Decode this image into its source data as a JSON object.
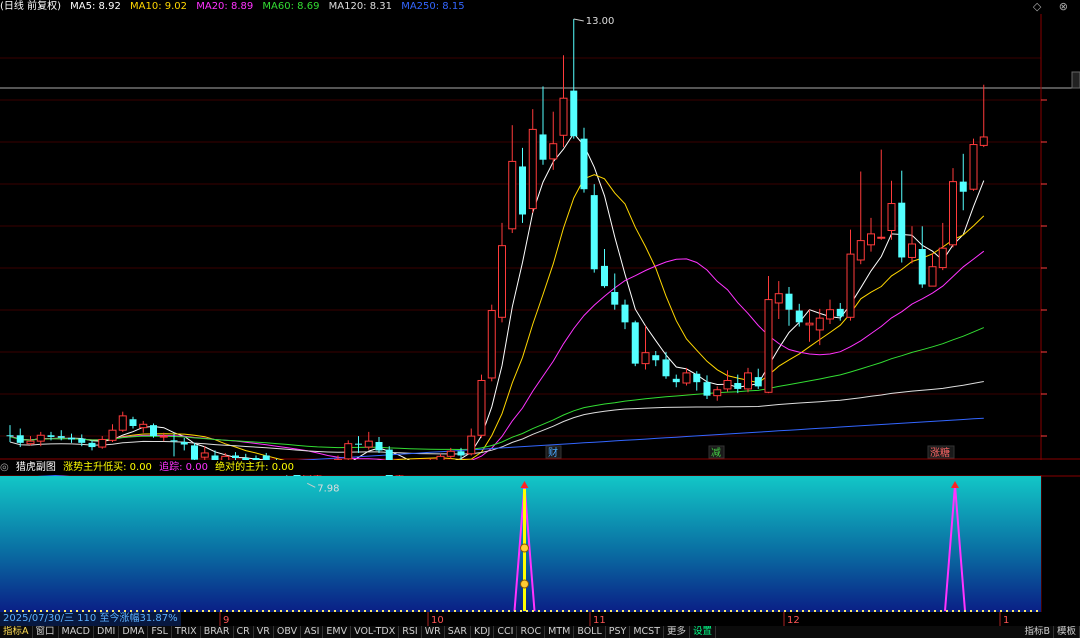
{
  "top_bar": {
    "title": "(日线 前复权)",
    "ma": [
      {
        "label": "MA5: 8.92",
        "color": "#ffffff"
      },
      {
        "label": "MA10: 9.02",
        "color": "#ffd700"
      },
      {
        "label": "MA20: 8.89",
        "color": "#ff33ff"
      },
      {
        "label": "MA60: 8.69",
        "color": "#33dd33"
      },
      {
        "label": "MA120: 8.31",
        "color": "#dddddd"
      },
      {
        "label": "MA250: 8.15",
        "color": "#3366ff"
      }
    ]
  },
  "chart": {
    "high_label": "13.00",
    "low_label": "7.98",
    "markers": [
      {
        "text": "财",
        "color": "#4aa8ff"
      },
      {
        "text": "减",
        "color": "#44cc44"
      },
      {
        "text": "涨糖",
        "color": "#ff6666"
      }
    ]
  },
  "sub_bar": {
    "name": "猎虎副图",
    "items": [
      {
        "label": "涨势主升低买: 0.00",
        "color": "#ffff00"
      },
      {
        "label": "追踪: 0.00",
        "color": "#ff33ff"
      },
      {
        "label": "绝对的主升: 0.00",
        "color": "#ffff00"
      }
    ]
  },
  "x_axis": {
    "months": [
      "9",
      "10",
      "11",
      "12",
      "1"
    ]
  },
  "date_info": "2025/07/30/三 110 至今涨幅31.87%",
  "tabs": [
    "指标A",
    "窗口",
    "MACD",
    "DMI",
    "DMA",
    "FSL",
    "TRIX",
    "BRAR",
    "CR",
    "VR",
    "OBV",
    "ASI",
    "EMV",
    "VOL-TDX",
    "RSI",
    "WR",
    "SAR",
    "KDJ",
    "CCI",
    "ROC",
    "MTM",
    "BOLL",
    "PSY",
    "MCST",
    "更多",
    "设置"
  ],
  "selected_tab": "设置",
  "tabs_right": [
    "指标B",
    "模板"
  ],
  "colors": {
    "up": "#ff3b3b",
    "down": "#54ffff",
    "ma5": "#ffffff",
    "ma10": "#ffd700",
    "ma20": "#ff33ff",
    "ma60": "#33dd33",
    "ma120": "#dddddd",
    "ma250": "#3366ff"
  },
  "candles": [
    [
      8.06,
      8.05,
      8.18,
      7.98
    ],
    [
      8.06,
      7.97,
      8.14,
      7.92
    ],
    [
      7.96,
      7.99,
      8.05,
      7.94
    ],
    [
      7.99,
      8.06,
      8.1,
      7.93
    ],
    [
      8.06,
      8.04,
      8.1,
      8.0
    ],
    [
      8.05,
      8.03,
      8.12,
      8.0
    ],
    [
      8.03,
      8.01,
      8.08,
      7.97
    ],
    [
      8.02,
      7.97,
      8.07,
      7.93
    ],
    [
      7.97,
      7.92,
      8.0,
      7.88
    ],
    [
      7.92,
      8.01,
      8.05,
      7.9
    ],
    [
      8.0,
      8.12,
      8.19,
      7.98
    ],
    [
      8.12,
      8.29,
      8.34,
      8.1
    ],
    [
      8.25,
      8.17,
      8.28,
      8.14
    ],
    [
      8.15,
      8.19,
      8.23,
      8.09
    ],
    [
      8.18,
      8.05,
      8.2,
      8.03
    ],
    [
      8.04,
      8.05,
      8.09,
      7.99
    ],
    [
      8.0,
      7.99,
      8.08,
      7.81
    ],
    [
      7.98,
      7.95,
      8.03,
      7.88
    ],
    [
      7.94,
      7.77,
      7.97,
      7.7
    ],
    [
      7.8,
      7.85,
      7.93,
      7.75
    ],
    [
      7.82,
      7.76,
      7.88,
      7.7
    ],
    [
      7.76,
      7.81,
      7.85,
      7.72
    ],
    [
      7.82,
      7.79,
      7.86,
      7.75
    ],
    [
      7.79,
      7.76,
      7.84,
      7.72
    ],
    [
      7.79,
      7.76,
      7.82,
      7.74
    ],
    [
      7.82,
      7.72,
      7.85,
      7.68
    ],
    [
      7.74,
      7.68,
      7.78,
      7.64
    ],
    [
      7.69,
      7.63,
      7.73,
      7.58
    ],
    [
      7.64,
      7.57,
      7.69,
      7.53
    ],
    [
      7.56,
      7.59,
      7.62,
      7.49
    ],
    [
      7.59,
      7.62,
      7.66,
      7.55
    ],
    [
      7.62,
      7.69,
      7.74,
      7.6
    ],
    [
      7.7,
      7.77,
      7.82,
      7.66
    ],
    [
      7.78,
      7.96,
      8.0,
      7.74
    ],
    [
      7.96,
      7.95,
      8.05,
      7.85
    ],
    [
      7.92,
      7.99,
      8.1,
      7.89
    ],
    [
      7.98,
      7.88,
      8.04,
      7.85
    ],
    [
      7.89,
      7.57,
      7.93,
      7.55
    ],
    [
      7.59,
      7.72,
      7.75,
      7.57
    ],
    [
      7.67,
      7.64,
      7.73,
      7.6
    ],
    [
      7.64,
      7.67,
      7.71,
      7.6
    ],
    [
      7.66,
      7.74,
      7.78,
      7.62
    ],
    [
      7.76,
      7.81,
      7.84,
      7.71
    ],
    [
      7.81,
      7.87,
      7.91,
      7.78
    ],
    [
      7.87,
      7.82,
      7.91,
      7.76
    ],
    [
      7.84,
      8.05,
      8.14,
      7.82
    ],
    [
      8.06,
      8.71,
      8.78,
      8.03
    ],
    [
      8.74,
      9.54,
      9.61,
      8.7
    ],
    [
      9.46,
      10.31,
      10.58,
      9.4
    ],
    [
      10.51,
      11.31,
      11.74,
      10.46
    ],
    [
      11.25,
      10.68,
      11.47,
      10.58
    ],
    [
      10.75,
      11.69,
      11.93,
      10.7
    ],
    [
      11.63,
      11.33,
      12.2,
      11.27
    ],
    [
      11.34,
      11.52,
      11.9,
      11.21
    ],
    [
      11.62,
      12.06,
      12.57,
      11.48
    ],
    [
      12.15,
      11.61,
      13.0,
      11.58
    ],
    [
      11.58,
      10.98,
      11.71,
      10.94
    ],
    [
      10.91,
      10.03,
      11.04,
      9.99
    ],
    [
      10.07,
      9.83,
      10.27,
      9.81
    ],
    [
      9.76,
      9.61,
      9.98,
      9.55
    ],
    [
      9.61,
      9.4,
      9.67,
      9.32
    ],
    [
      9.4,
      8.91,
      9.42,
      8.88
    ],
    [
      8.91,
      9.04,
      9.36,
      8.84
    ],
    [
      9.01,
      8.95,
      9.06,
      8.88
    ],
    [
      8.96,
      8.76,
      9.05,
      8.73
    ],
    [
      8.73,
      8.69,
      8.78,
      8.63
    ],
    [
      8.68,
      8.8,
      8.86,
      8.65
    ],
    [
      8.79,
      8.69,
      8.82,
      8.59
    ],
    [
      8.69,
      8.53,
      8.77,
      8.49
    ],
    [
      8.53,
      8.6,
      8.64,
      8.47
    ],
    [
      8.61,
      8.71,
      8.83,
      8.58
    ],
    [
      8.68,
      8.61,
      8.78,
      8.56
    ],
    [
      8.61,
      8.8,
      8.86,
      8.57
    ],
    [
      8.75,
      8.64,
      8.85,
      8.61
    ],
    [
      8.57,
      9.67,
      9.95,
      8.56
    ],
    [
      9.63,
      9.74,
      9.89,
      9.44
    ],
    [
      9.74,
      9.55,
      9.82,
      9.36
    ],
    [
      9.54,
      9.4,
      9.62,
      9.35
    ],
    [
      9.37,
      9.39,
      9.55,
      9.17
    ],
    [
      9.31,
      9.45,
      9.56,
      9.13
    ],
    [
      9.44,
      9.55,
      9.67,
      9.38
    ],
    [
      9.56,
      9.47,
      9.63,
      9.42
    ],
    [
      9.46,
      10.21,
      10.5,
      9.42
    ],
    [
      10.14,
      10.37,
      11.19,
      10.09
    ],
    [
      10.32,
      10.45,
      10.64,
      10.24
    ],
    [
      10.4,
      10.41,
      11.45,
      10.38
    ],
    [
      10.49,
      10.81,
      11.08,
      10.38
    ],
    [
      10.82,
      10.17,
      11.2,
      10.11
    ],
    [
      10.17,
      10.33,
      10.54,
      10.1
    ],
    [
      10.27,
      9.85,
      10.54,
      9.81
    ],
    [
      9.83,
      10.06,
      10.22,
      10.0
    ],
    [
      10.05,
      10.28,
      10.58,
      10.02
    ],
    [
      10.32,
      11.07,
      11.23,
      10.29
    ],
    [
      11.07,
      10.95,
      11.4,
      10.73
    ],
    [
      10.98,
      11.51,
      11.58,
      10.96
    ],
    [
      11.5,
      11.6,
      12.22,
      11.48
    ]
  ],
  "signals_yellow": [
    50
  ],
  "signals_magenta": [
    50,
    92
  ]
}
